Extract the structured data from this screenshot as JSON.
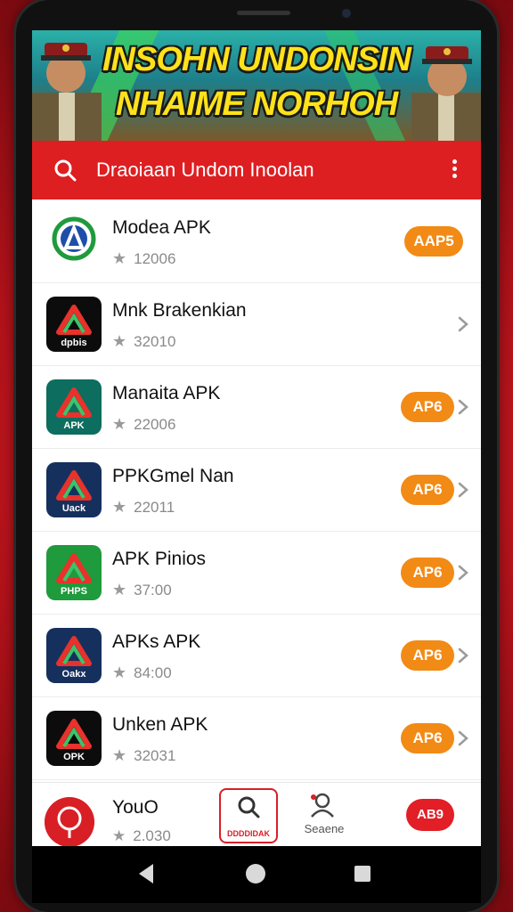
{
  "banner": {
    "line1": "INSOHN UNDONSIN",
    "line2": "NHAIME NORHOH"
  },
  "search": {
    "text": "Draoiaan Undom Inoolan"
  },
  "apps": [
    {
      "name": "Modea APK",
      "rating": "12006",
      "button": "AAP5",
      "icon_label": "",
      "icon_color": "#ffffff",
      "chevron": false
    },
    {
      "name": "Mnk Brakenkian",
      "rating": "32010",
      "button": "",
      "icon_label": "dpbis",
      "icon_color": "#0c0c0c",
      "chevron": true
    },
    {
      "name": "Manaita APK",
      "rating": "22006",
      "button": "AP6",
      "icon_label": "APK",
      "icon_color": "#0d6d5f",
      "chevron": true
    },
    {
      "name": "PPKGmel Nan",
      "rating": "22011",
      "button": "AP6",
      "icon_label": "Uack",
      "icon_color": "#16305e",
      "chevron": true
    },
    {
      "name": "APK Pinios",
      "rating": "37:00",
      "button": "AP6",
      "icon_label": "PHPS",
      "icon_color": "#1f9a3c",
      "chevron": true
    },
    {
      "name": "APKs APK",
      "rating": "84:00",
      "button": "AP6",
      "icon_label": "Oakx",
      "icon_color": "#16305e",
      "chevron": true
    },
    {
      "name": "Unken APK",
      "rating": "32031",
      "button": "AP6",
      "icon_label": "OPK",
      "icon_color": "#0c0c0c",
      "chevron": true
    }
  ],
  "bottom": {
    "name": "YouO",
    "rating": "2.030",
    "search_label": "DDDDIDAK",
    "people_label": "Seaene",
    "badge": "AB9"
  },
  "colors": {
    "primary": "#dd1f22",
    "pill": "#f28a16"
  }
}
